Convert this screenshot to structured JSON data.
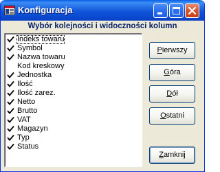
{
  "window": {
    "title": "Konfiguracja"
  },
  "heading": "Wybór kolejności i widoczności kolumn",
  "columns": [
    {
      "label": "Indeks towaru",
      "checked": true
    },
    {
      "label": "Symbol",
      "checked": true
    },
    {
      "label": "Nazwa towaru",
      "checked": true
    },
    {
      "label": "Kod kreskowy",
      "checked": false
    },
    {
      "label": "Jednostka",
      "checked": true
    },
    {
      "label": "Ilość",
      "checked": true
    },
    {
      "label": "Ilość zarez.",
      "checked": true
    },
    {
      "label": "Netto",
      "checked": true
    },
    {
      "label": "Brutto",
      "checked": true
    },
    {
      "label": "VAT",
      "checked": true
    },
    {
      "label": "Magazyn",
      "checked": true
    },
    {
      "label": "Typ",
      "checked": true
    },
    {
      "label": "Status",
      "checked": true
    }
  ],
  "buttons": {
    "first": {
      "pre": "",
      "mnemonic": "P",
      "post": "ierwszy"
    },
    "up": {
      "pre": "",
      "mnemonic": "G",
      "post": "óra"
    },
    "down": {
      "pre": "",
      "mnemonic": "D",
      "post": "ół"
    },
    "last": {
      "pre": "",
      "mnemonic": "O",
      "post": "statni"
    },
    "close": {
      "pre": "",
      "mnemonic": "Z",
      "post": "amknij"
    }
  },
  "colors": {
    "titlebar": "#0a5fe6",
    "heading": "#0a246a",
    "checkmark": "#000000"
  },
  "icons": [
    "app-icon",
    "minimize-icon",
    "maximize-icon",
    "close-icon",
    "checkbox-checked-icon"
  ]
}
